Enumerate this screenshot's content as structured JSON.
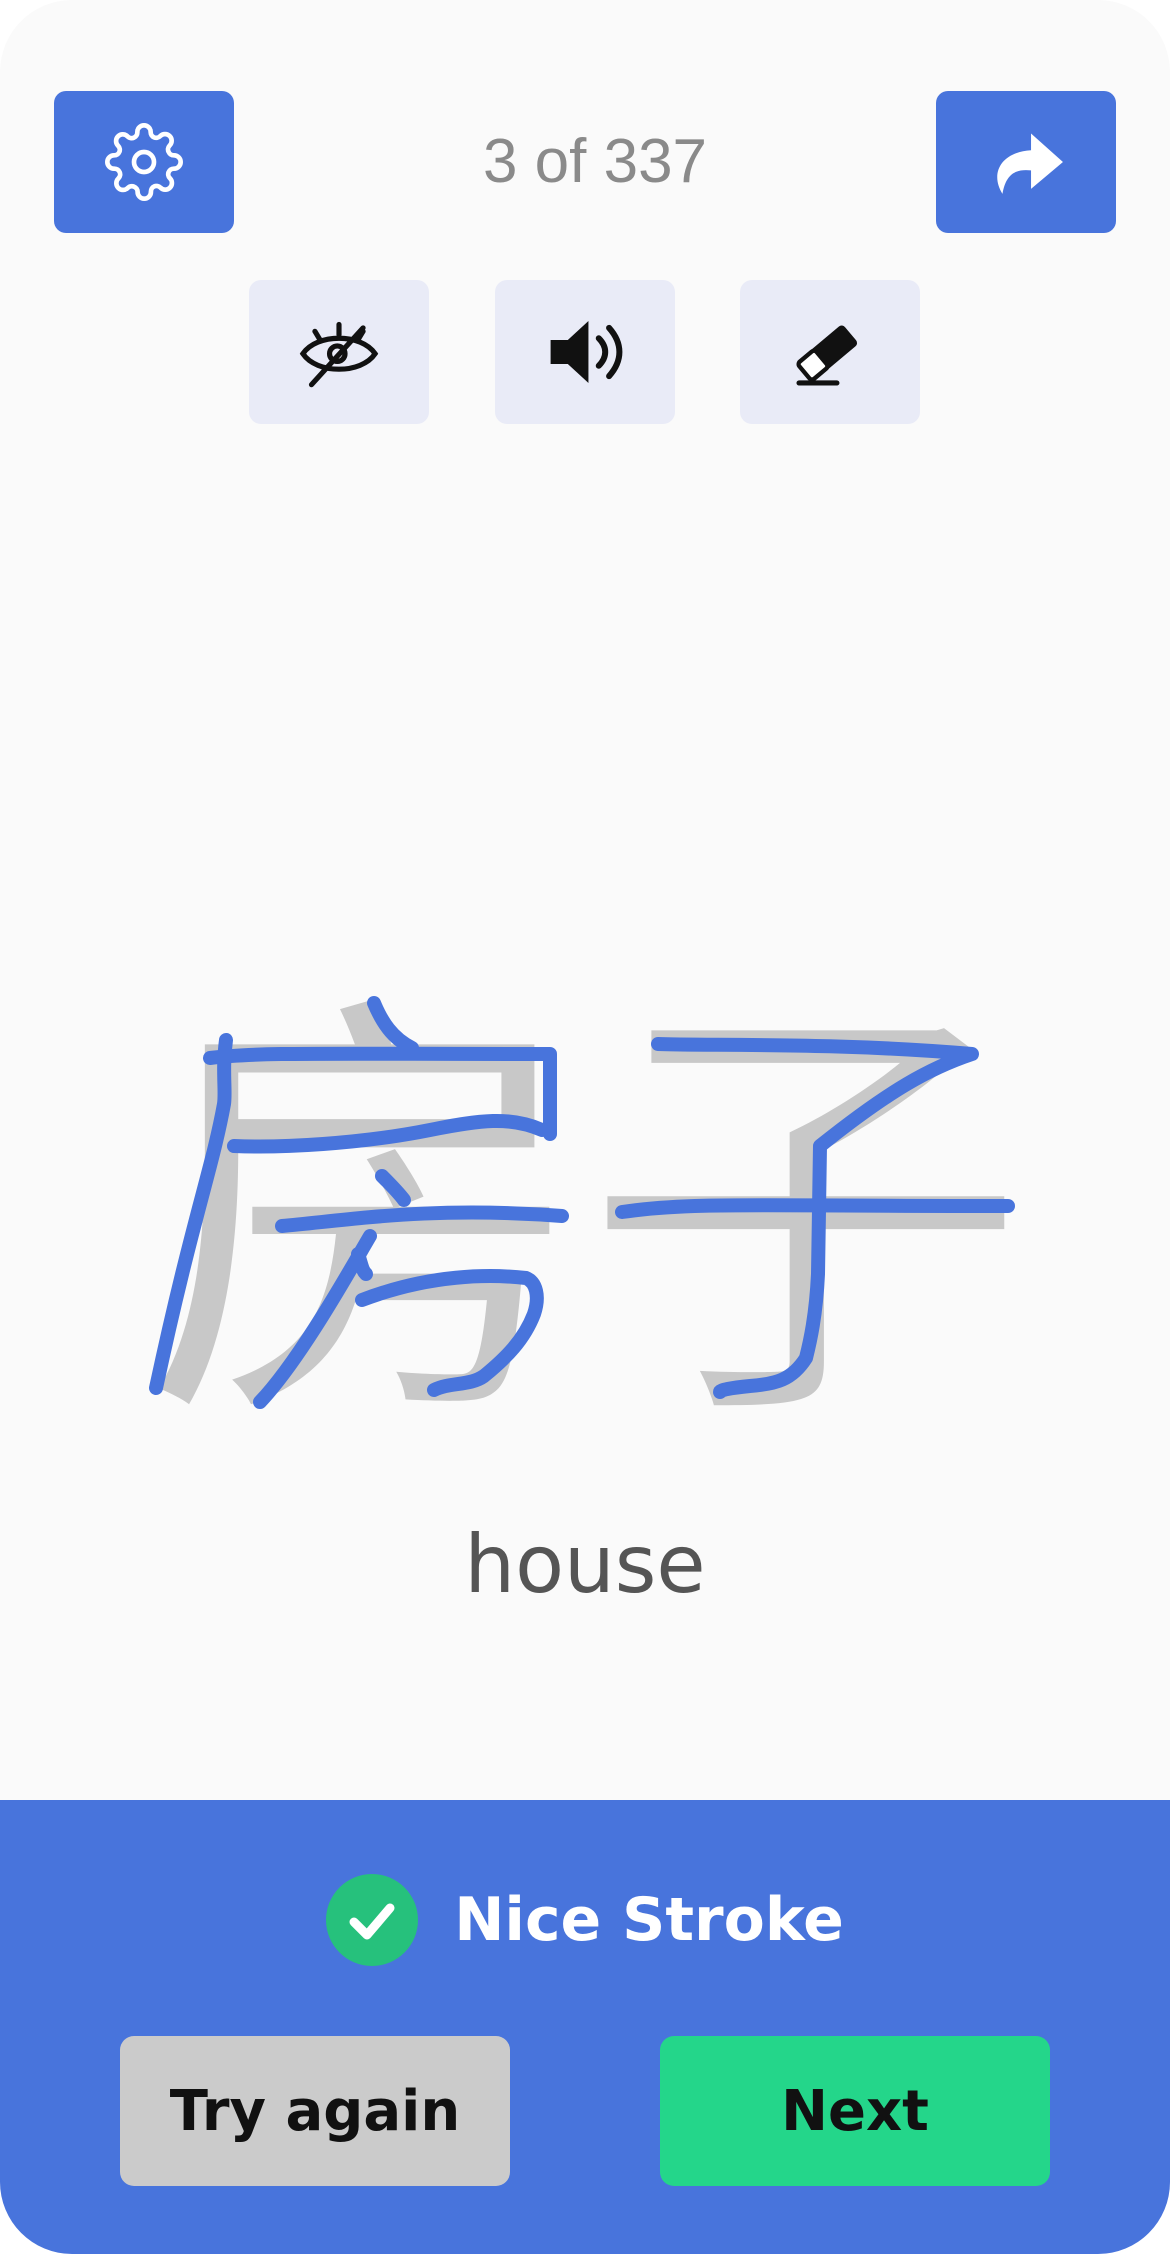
{
  "header": {
    "counter": "3 of 337",
    "settings_icon": "gear-icon",
    "redo_icon": "redo-arrow-icon"
  },
  "tools": {
    "hide_icon": "eye-off-icon",
    "sound_icon": "speaker-icon",
    "erase_icon": "eraser-icon"
  },
  "card": {
    "character": "房子",
    "meaning": "house"
  },
  "feedback": {
    "message": "Nice Stroke",
    "status_icon": "check-circle-icon",
    "try_again_label": "Try again",
    "next_label": "Next"
  },
  "colors": {
    "primary": "#4874dc",
    "success": "#24d68a",
    "secondary_button": "#cbcbcb",
    "tool_bg": "#e9ebf7",
    "ghost_glyph": "#c8c8c8"
  }
}
